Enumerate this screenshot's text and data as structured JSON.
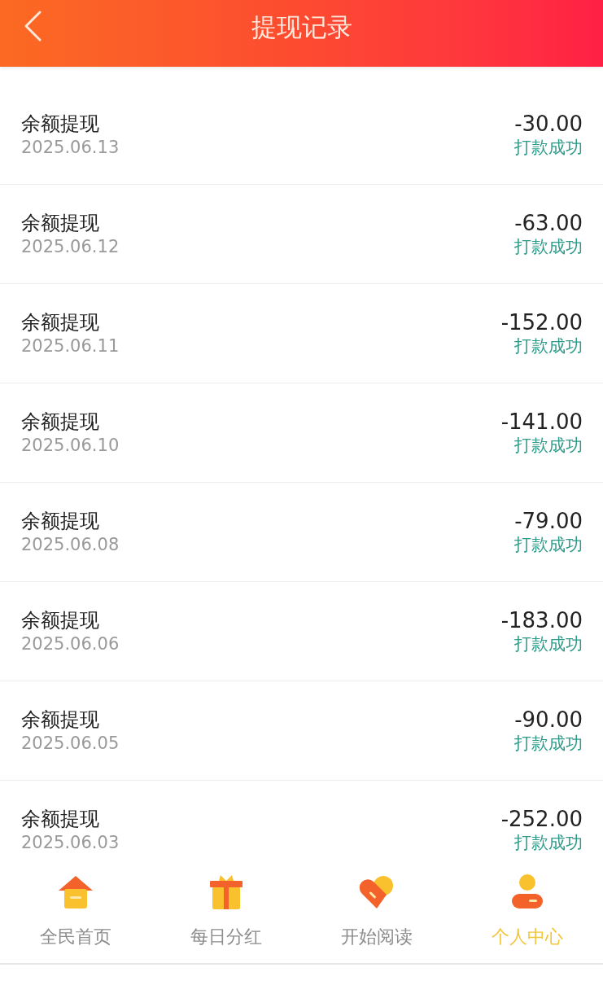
{
  "header": {
    "title": "提现记录"
  },
  "records": [
    {
      "title": "余额提现",
      "date": "2025.06.13",
      "amount": "-30.00",
      "status": "打款成功"
    },
    {
      "title": "余额提现",
      "date": "2025.06.12",
      "amount": "-63.00",
      "status": "打款成功"
    },
    {
      "title": "余额提现",
      "date": "2025.06.11",
      "amount": "-152.00",
      "status": "打款成功"
    },
    {
      "title": "余额提现",
      "date": "2025.06.10",
      "amount": "-141.00",
      "status": "打款成功"
    },
    {
      "title": "余额提现",
      "date": "2025.06.08",
      "amount": "-79.00",
      "status": "打款成功"
    },
    {
      "title": "余额提现",
      "date": "2025.06.06",
      "amount": "-183.00",
      "status": "打款成功"
    },
    {
      "title": "余额提现",
      "date": "2025.06.05",
      "amount": "-90.00",
      "status": "打款成功"
    },
    {
      "title": "余额提现",
      "date": "2025.06.03",
      "amount": "-252.00",
      "status": "打款成功"
    }
  ],
  "tab_bar": [
    {
      "label": "全民首页",
      "kind": "home",
      "selected": false
    },
    {
      "label": "每日分红",
      "kind": "gift",
      "selected": false
    },
    {
      "label": "开始阅读",
      "kind": "heart",
      "selected": false
    },
    {
      "label": "个人中心",
      "kind": "person",
      "selected": true
    }
  ]
}
